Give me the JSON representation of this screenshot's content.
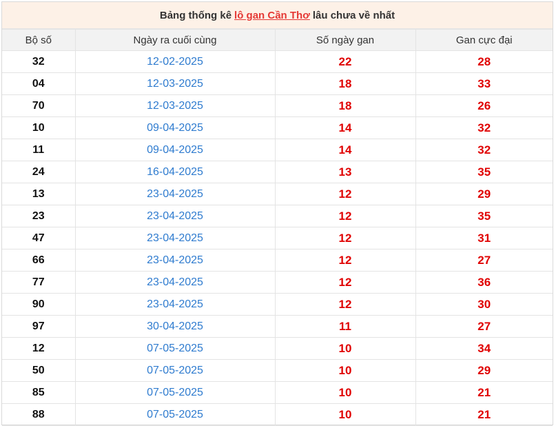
{
  "title": {
    "prefix": "Bảng thống kê",
    "link": "lô gan Cần Thơ",
    "suffix": "lâu chưa về nhất"
  },
  "headers": [
    "Bộ số",
    "Ngày ra cuối cùng",
    "Số ngày gan",
    "Gan cực đại"
  ],
  "rows": [
    {
      "so": "32",
      "ngay": "12-02-2025",
      "gan": "22",
      "max": "28"
    },
    {
      "so": "04",
      "ngay": "12-03-2025",
      "gan": "18",
      "max": "33"
    },
    {
      "so": "70",
      "ngay": "12-03-2025",
      "gan": "18",
      "max": "26"
    },
    {
      "so": "10",
      "ngay": "09-04-2025",
      "gan": "14",
      "max": "32"
    },
    {
      "so": "11",
      "ngay": "09-04-2025",
      "gan": "14",
      "max": "32"
    },
    {
      "so": "24",
      "ngay": "16-04-2025",
      "gan": "13",
      "max": "35"
    },
    {
      "so": "13",
      "ngay": "23-04-2025",
      "gan": "12",
      "max": "29"
    },
    {
      "so": "23",
      "ngay": "23-04-2025",
      "gan": "12",
      "max": "35"
    },
    {
      "so": "47",
      "ngay": "23-04-2025",
      "gan": "12",
      "max": "31"
    },
    {
      "so": "66",
      "ngay": "23-04-2025",
      "gan": "12",
      "max": "27"
    },
    {
      "so": "77",
      "ngay": "23-04-2025",
      "gan": "12",
      "max": "36"
    },
    {
      "so": "90",
      "ngay": "23-04-2025",
      "gan": "12",
      "max": "30"
    },
    {
      "so": "97",
      "ngay": "30-04-2025",
      "gan": "11",
      "max": "27"
    },
    {
      "so": "12",
      "ngay": "07-05-2025",
      "gan": "10",
      "max": "34"
    },
    {
      "so": "50",
      "ngay": "07-05-2025",
      "gan": "10",
      "max": "29"
    },
    {
      "so": "85",
      "ngay": "07-05-2025",
      "gan": "10",
      "max": "21"
    },
    {
      "so": "88",
      "ngay": "07-05-2025",
      "gan": "10",
      "max": "21"
    }
  ],
  "colors": {
    "link": "#e53935",
    "date": "#2e7bcf",
    "value": "#e00000",
    "title_bg": "#fdf1e7"
  }
}
